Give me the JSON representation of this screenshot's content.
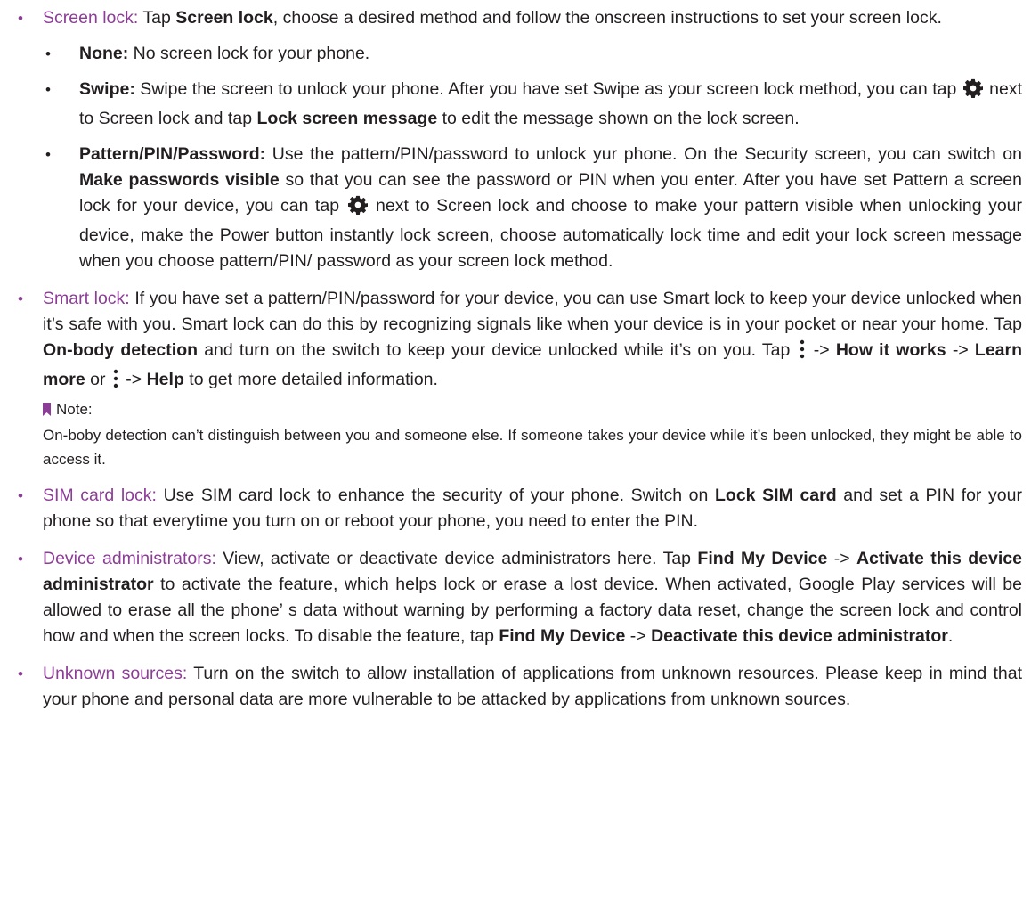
{
  "accent": "#8c3d96",
  "screen_lock": {
    "term": "Screen lock:",
    "t1": " Tap ",
    "b1": "Screen lock",
    "t2": ", choose a desired method and follow the onscreen instructions to set your screen lock.",
    "none": {
      "term": "None:",
      "text": " No screen lock for your phone."
    },
    "swipe": {
      "term": "Swipe:",
      "t1": " Swipe the screen to unlock your phone. After you have set Swipe as your screen lock method, you can tap ",
      "icon": "gear-icon",
      "t2": " next to Screen lock and tap ",
      "b1": "Lock screen message",
      "t3": " to edit the message shown on the lock screen."
    },
    "pattern": {
      "term": "Pattern/PIN/Password:",
      "t1": " Use the pattern/PIN/password to unlock yur phone. On the Security screen, you can switch on ",
      "b1": "Make passwords visible",
      "t2": " so that you can see the password or PIN when you enter. After you have set Pattern a screen lock for your device, you can tap ",
      "icon": "gear-icon",
      "t3": " next to Screen lock and choose to make your pattern visible when unlocking your device, make the Power button instantly lock screen, choose automatically lock time and edit your lock screen message when you choose pattern/PIN/ password as your screen lock method."
    }
  },
  "smart_lock": {
    "term": "Smart lock:",
    "t1": " If you have set a pattern/PIN/password for your device, you can use Smart lock to keep your device unlocked when it’s safe with you. Smart lock can do this by recognizing signals like when your device is in your pocket or near your home. Tap ",
    "b1": "On-body detection",
    "t2": " and turn on the switch to keep your device unlocked while it’s on you. Tap ",
    "icon": "more-vert-icon",
    "t3": " -> ",
    "b2": "How it works",
    "t4": " -> ",
    "b3": "Learn more",
    "t5": " or ",
    "t6": " -> ",
    "b4": "Help",
    "t7": " to get more detailed information.",
    "note_label": "Note:",
    "note_text": "On-boby detection can’t distinguish between you and someone else. If someone takes your device while it’s been unlocked, they might be able to access it."
  },
  "sim_lock": {
    "term": "SIM card lock:",
    "t1": " Use SIM card lock to enhance the security of your phone. Switch on ",
    "b1": "Lock SIM card",
    "t2": " and set a PIN for your phone so that everytime you turn on or reboot your phone, you need to enter the PIN."
  },
  "device_admin": {
    "term": "Device administrators:",
    "t1": " View, activate or deactivate device administrators here. Tap ",
    "b1": "Find My Device",
    "t2": " -> ",
    "b2": "Activate this device administrator",
    "t3": " to activate the feature, which helps lock or erase a lost device. When activated, Google Play services will be allowed to erase all the phone’ s data without warning by performing a factory data reset, change the screen lock and control how and when the screen locks. To disable the feature, tap ",
    "b3": "Find My Device",
    "t4": " -> ",
    "b4": "Deactivate this device administrator",
    "t5": "."
  },
  "unknown_sources": {
    "term": "Unknown sources:",
    "t1": " Turn on the switch to allow installation of applications from unknown resources. Please keep in mind that your phone and personal data are more vulnerable to be attacked by applications from unknown sources."
  }
}
